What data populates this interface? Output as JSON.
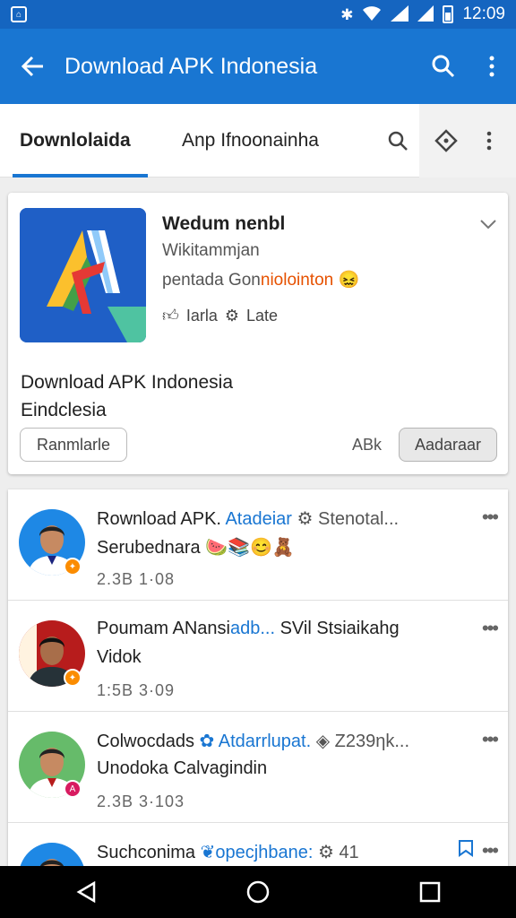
{
  "status_bar": {
    "time": "12:09"
  },
  "app_bar": {
    "title": "Download APK Indonesia",
    "back_icon": "arrow-left-icon",
    "search_icon": "search-icon",
    "menu_icon": "more-vert-icon"
  },
  "tabs": [
    {
      "label": "Downlolaida"
    },
    {
      "label": "Anp Ifnoonainha"
    }
  ],
  "featured": {
    "name": "Wedum nenbl",
    "developer": "Wikitammjan",
    "tagline_a": "pentada Gon",
    "tagline_b": "niolointon",
    "rating": "Iarla",
    "update": "Late",
    "description_line1": "Download APK Indonesia",
    "description_line2": "Eindclesia",
    "left_button": "Ranmlarle",
    "size": "ABk",
    "right_button": "Aadaraar"
  },
  "list": [
    {
      "title": "Rownload APK.",
      "title_hl": "Atadeiar",
      "title_dim": "Stenotal...",
      "subtitle": "Serubednara",
      "meta": "2.3B  1·08"
    },
    {
      "title": "Poumam ANansi",
      "title_hl": "adb...",
      "title_dim": "SVil Stsiaikahg",
      "subtitle": "Vidok",
      "meta": "1:5B  3·09"
    },
    {
      "title": "Colwocdads",
      "title_hl": "Atdarrlupat.",
      "title_dim": "Z239ηk...",
      "subtitle": "Unodoka Calvagindin",
      "meta": "2.3B  3·103"
    },
    {
      "title": "Suchconima",
      "title_hl": "opecjhbane:",
      "title_dim": "41",
      "subtitle": "",
      "meta": ""
    }
  ],
  "colors": {
    "primary": "#1976d2",
    "status_bar": "#1565c0",
    "accent": "#e65100"
  }
}
